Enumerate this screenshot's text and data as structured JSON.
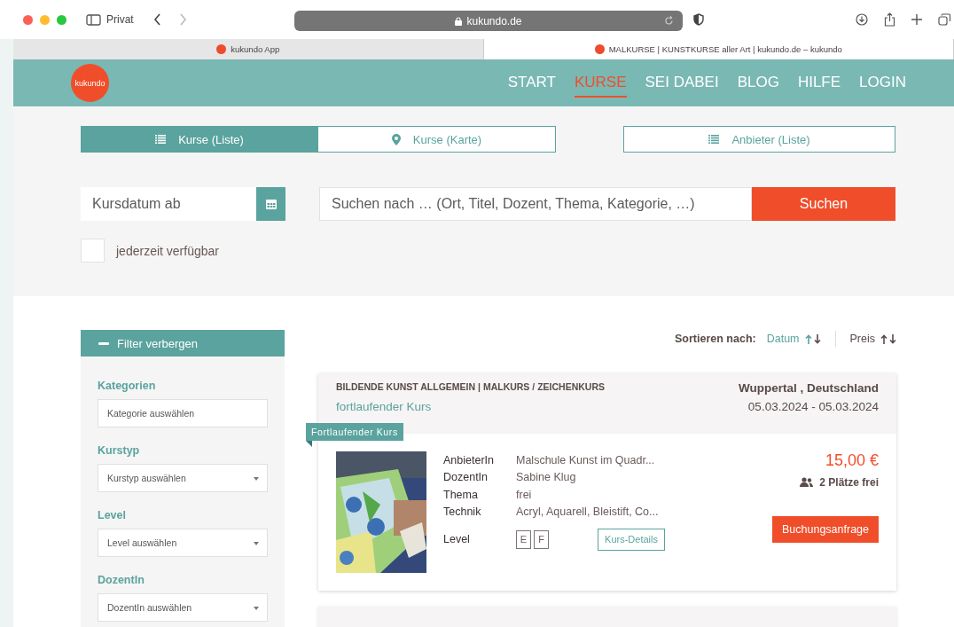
{
  "browser": {
    "private_label": "Privat",
    "url": "kukundo.de",
    "tabs": [
      {
        "title": "kukundo App",
        "selected": false
      },
      {
        "title": "MALKURSE | KUNSTKURSE aller Art | kukundo.de – kukundo",
        "selected": true
      }
    ]
  },
  "header": {
    "logo": "kukundo",
    "nav": [
      {
        "label": "START",
        "selected": false
      },
      {
        "label": "KURSE",
        "selected": true
      },
      {
        "label": "SEI DABEI",
        "selected": false
      },
      {
        "label": "BLOG",
        "selected": false
      },
      {
        "label": "HILFE",
        "selected": false
      },
      {
        "label": "LOGIN",
        "selected": false
      }
    ]
  },
  "view_tabs": [
    {
      "label": "Kurse (Liste)",
      "kind": "list",
      "selected": true
    },
    {
      "label": "Kurse (Karte)",
      "kind": "map",
      "selected": false
    },
    {
      "label": "Anbieter (Liste)",
      "kind": "list",
      "selected": false
    }
  ],
  "search": {
    "date_placeholder": "Kursdatum ab",
    "query_placeholder": "Suchen nach … (Ort, Titel, Dozent, Thema, Kategorie, …)",
    "button": "Suchen",
    "anytime": {
      "label": "jederzeit verfügbar",
      "checked": false
    }
  },
  "filter": {
    "toggle": "Filter verbergen",
    "groups": [
      {
        "label": "Kategorien",
        "placeholder": "Kategorie auswählen",
        "kind": "text"
      },
      {
        "label": "Kurstyp",
        "placeholder": "Kurstyp auswählen",
        "kind": "select"
      },
      {
        "label": "Level",
        "placeholder": "Level auswählen",
        "kind": "select"
      },
      {
        "label": "DozentIn",
        "placeholder": "DozentIn auswählen",
        "kind": "select"
      }
    ]
  },
  "sort": {
    "label": "Sortieren nach:",
    "options": [
      {
        "label": "Datum",
        "selected": true
      },
      {
        "label": "Preis",
        "selected": false
      }
    ]
  },
  "courses": [
    {
      "categories": "BILDENDE KUNST ALLGEMEIN | MALKURS / ZEICHENKURS",
      "type": "fortlaufender Kurs",
      "location": "Wuppertal , Deutschland",
      "dates": "05.03.2024 - 05.03.2024",
      "ribbon": "Fortlaufender Kurs",
      "details": [
        {
          "label": "AnbieterIn",
          "value": "Malschule Kunst im Quadr..."
        },
        {
          "label": "DozentIn",
          "value": "Sabine Klug"
        },
        {
          "label": "Thema",
          "value": "frei"
        },
        {
          "label": "Technik",
          "value": "Acryl, Aquarell, Bleistift, Co..."
        }
      ],
      "level_label": "Level",
      "levels": [
        "E",
        "F"
      ],
      "details_button": "Kurs-Details",
      "price": "15,00 €",
      "seats": "2 Plätze frei",
      "book_button": "Buchungsanfrage"
    }
  ]
}
